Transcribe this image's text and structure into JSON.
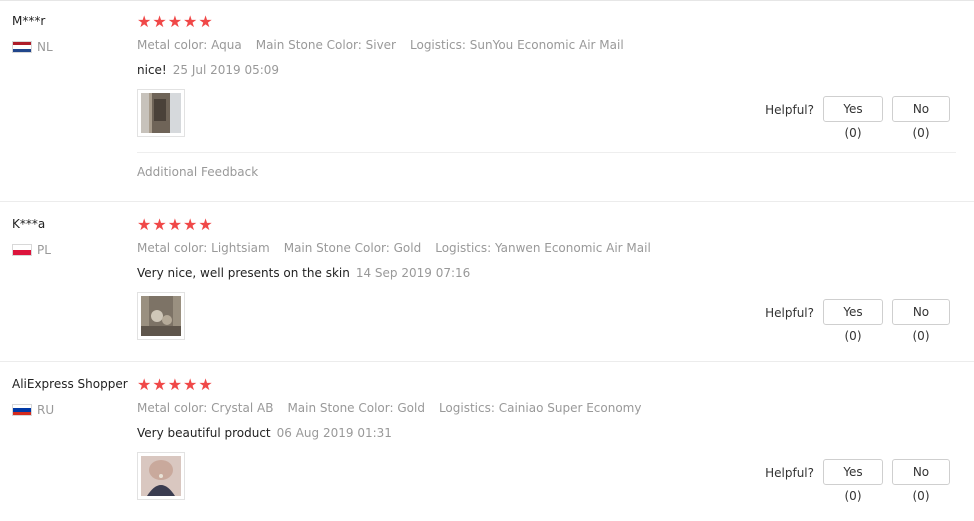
{
  "labels": {
    "helpful": "Helpful?",
    "additional_feedback": "Additional Feedback"
  },
  "reviews": [
    {
      "user": "M***r",
      "country": "NL",
      "flag_colors": [
        "#ae1c28",
        "#ffffff",
        "#21468b"
      ],
      "stars": "★★★★★",
      "attrs": [
        "Metal color: Aqua",
        "Main Stone Color: Siver",
        "Logistics: SunYou Economic Air Mail"
      ],
      "text": "nice!",
      "date": "25 Jul 2019 05:09",
      "yes": "Yes (0)",
      "no": "No (0)"
    },
    {
      "user": "K***a",
      "country": "PL",
      "flag_colors": [
        "#ffffff",
        "#dc143c"
      ],
      "stars": "★★★★★",
      "attrs": [
        "Metal color: Lightsiam",
        "Main Stone Color: Gold",
        "Logistics: Yanwen Economic Air Mail"
      ],
      "text": "Very nice, well presents on the skin",
      "date": "14 Sep 2019 07:16",
      "yes": "Yes (0)",
      "no": "No (0)"
    },
    {
      "user": "AliExpress Shopper",
      "country": "RU",
      "flag_colors": [
        "#ffffff",
        "#0039a6",
        "#d52b1e"
      ],
      "stars": "★★★★★",
      "attrs": [
        "Metal color: Crystal AB",
        "Main Stone Color: Gold",
        "Logistics: Cainiao Super Economy"
      ],
      "text": "Very beautiful product",
      "date": "06 Aug 2019 01:31",
      "yes": "Yes (0)",
      "no": "No (0)"
    }
  ],
  "colors": {
    "star": "#f04848",
    "muted_text": "#999999"
  }
}
